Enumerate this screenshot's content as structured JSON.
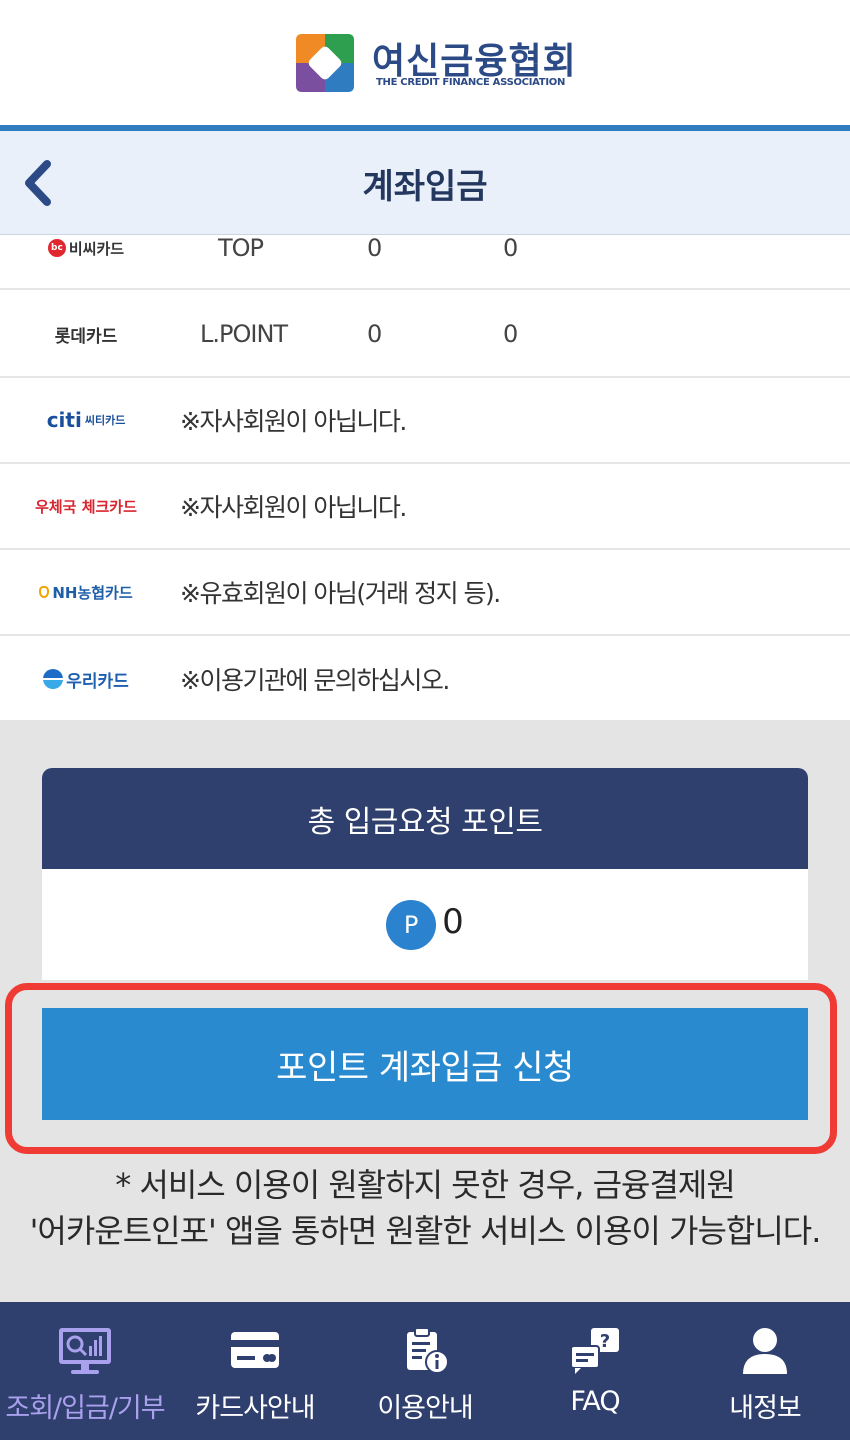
{
  "logo": {
    "title": "여신금융협회",
    "subtitle": "THE CREDIT FINANCE ASSOCIATION"
  },
  "header": {
    "title": "계좌입금",
    "back_icon": "chevron-left-icon"
  },
  "rows": [
    {
      "brand": "비씨카드",
      "point_name": "TOP",
      "col3": "0",
      "col4": "0"
    },
    {
      "brand": "롯데카드",
      "point_name": "L.POINT",
      "col3": "0",
      "col4": "0"
    },
    {
      "brand": "씨티카드",
      "brand_mark": "citi",
      "message": "※자사회원이 아닙니다."
    },
    {
      "brand": "우체국 체크카드",
      "message": "※자사회원이 아닙니다."
    },
    {
      "brand": "NH농협카드",
      "message": "※유효회원이 아님(거래 정지 등)."
    },
    {
      "brand": "우리카드",
      "message": "※이용기관에 문의하십시오."
    }
  ],
  "total": {
    "heading": "총 입금요청 포인트",
    "badge": "P",
    "value": "0"
  },
  "apply_button": "포인트 계좌입금 신청",
  "notice": {
    "line1": "* 서비스 이용이 원활하지 못한 경우, 금융결제원",
    "line2": "'어카운트인포' 앱을 통하면 원활한 서비스 이용이 가능합니다."
  },
  "nav": [
    {
      "label": "조회/입금/기부",
      "icon": "chart-monitor-icon",
      "active": true
    },
    {
      "label": "카드사안내",
      "icon": "credit-card-icon",
      "active": false
    },
    {
      "label": "이용안내",
      "icon": "clipboard-info-icon",
      "active": false
    },
    {
      "label": "FAQ",
      "icon": "question-chat-icon",
      "active": false
    },
    {
      "label": "내정보",
      "icon": "user-icon",
      "active": false
    }
  ],
  "colors": {
    "brand_blue": "#2c4a86",
    "nav_bg": "#2f3f6e",
    "button_blue": "#2a8ad0",
    "highlight_red": "#ef3b33",
    "active_nav": "#a9a0ee"
  }
}
